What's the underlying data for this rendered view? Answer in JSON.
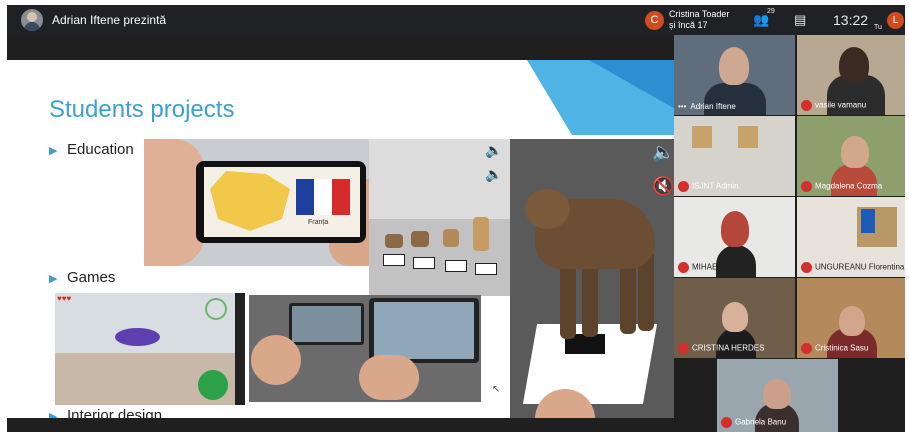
{
  "topbar": {
    "presenting_text": "Adrian Iftene prezintă",
    "participants_avatar_letter": "C",
    "participants_line1": "Cristina Toader",
    "participants_line2": "și încă 17",
    "people_count": "29",
    "clock": "13:22",
    "user_avatar_letter": "L",
    "you_label": "Tu"
  },
  "slide": {
    "title": "Students projects",
    "bullets": [
      "Education",
      "Games",
      "Interior design"
    ],
    "flag_label": "Franța",
    "game_hearts": "♥♥♥"
  },
  "participants": [
    {
      "name": "Adrian Iftene",
      "muted": false
    },
    {
      "name": "vasile vamanu",
      "muted": true
    },
    {
      "name": "ISJNT Admin",
      "muted": true
    },
    {
      "name": "Magdalena Cozma",
      "muted": true
    },
    {
      "name": "MIHAELA MONU",
      "muted": true
    },
    {
      "name": "UNGUREANU Florentina",
      "muted": true
    },
    {
      "name": "CRISTINA HERDES",
      "muted": true
    },
    {
      "name": "Cristinica Sasu",
      "muted": true
    },
    {
      "name": "Gabriela Banu",
      "muted": true
    }
  ],
  "colors": {
    "accent": "#3d9fd8",
    "mute_red": "#d32f2f",
    "avatar_orange": "#d04a22",
    "background": "#202124"
  }
}
